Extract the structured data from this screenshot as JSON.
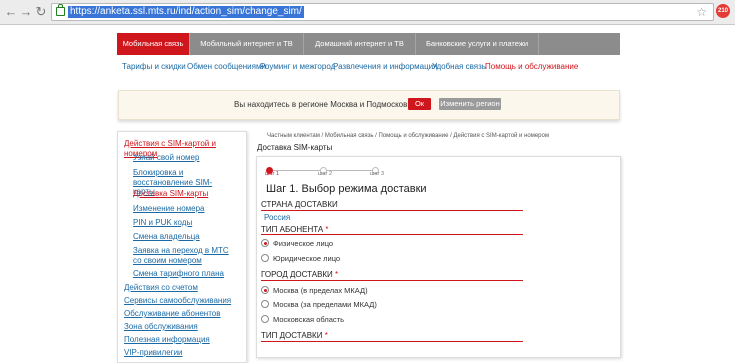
{
  "browser": {
    "url": "https://anketa.ssl.mts.ru/ind/action_sim/change_sim/",
    "extension_badge": "210"
  },
  "topnav": {
    "tabs": [
      {
        "label": "Мобильная связь"
      },
      {
        "label": "Мобильный интернет и ТВ"
      },
      {
        "label": "Домашний интернет и ТВ"
      },
      {
        "label": "Банковские услуги и платежи"
      }
    ]
  },
  "subnav": {
    "items": [
      {
        "label": "Тарифы и скидки"
      },
      {
        "label": "Обмен сообщениями"
      },
      {
        "label": "Роуминг и межгород"
      },
      {
        "label": "Развлечения и информация"
      },
      {
        "label": "Удобная связь"
      },
      {
        "label": "Помощь и обслуживание"
      }
    ]
  },
  "region": {
    "message": "Вы находитесь в регионе Москва и Подмосковье.",
    "ok_label": "Ок",
    "change_label": "Изменить регион"
  },
  "sidebar": {
    "items": [
      {
        "label": "Действия с SIM-картой и номером"
      },
      {
        "label": "Узнай свой номер"
      },
      {
        "label": "Блокировка и восстановление SIM-карты"
      },
      {
        "label": "Доставка SIM-карты"
      },
      {
        "label": "Изменение номера"
      },
      {
        "label": "PIN и PUK коды"
      },
      {
        "label": "Смена владельца"
      },
      {
        "label": "Заявка на переход в МТС со своим номером"
      },
      {
        "label": "Смена тарифного плана"
      },
      {
        "label": "Действия со счетом"
      },
      {
        "label": "Сервисы самообслуживания"
      },
      {
        "label": "Обслуживание абонентов"
      },
      {
        "label": "Зона обслуживания"
      },
      {
        "label": "Полезная информация"
      },
      {
        "label": "VIP-привилегии"
      }
    ]
  },
  "breadcrumb": "Частным клиентам / Мобильная связь / Помощь и обслуживание / Действия с SIM-картой и номером",
  "page_title": "Доставка SIM-карты",
  "steps": [
    {
      "label": "шаг 1"
    },
    {
      "label": "шаг 2"
    },
    {
      "label": "шаг 3"
    }
  ],
  "form": {
    "step_title": "Шаг 1. Выбор режима доставки",
    "country_label": "СТРАНА ДОСТАВКИ",
    "country_value": "Россия",
    "subscriber_label": "ТИП АБОНЕНТА",
    "subscriber_options": [
      {
        "label": "Физическое лицо",
        "selected": true
      },
      {
        "label": "Юридическое лицо",
        "selected": false
      }
    ],
    "city_label": "ГОРОД ДОСТАВКИ",
    "city_options": [
      {
        "label": "Москва (в пределах МКАД)",
        "selected": true
      },
      {
        "label": "Москва (за пределами МКАД)",
        "selected": false
      },
      {
        "label": "Московская область",
        "selected": false
      }
    ],
    "delivery_type_label": "ТИП ДОСТАВКИ",
    "required_mark": "*"
  }
}
